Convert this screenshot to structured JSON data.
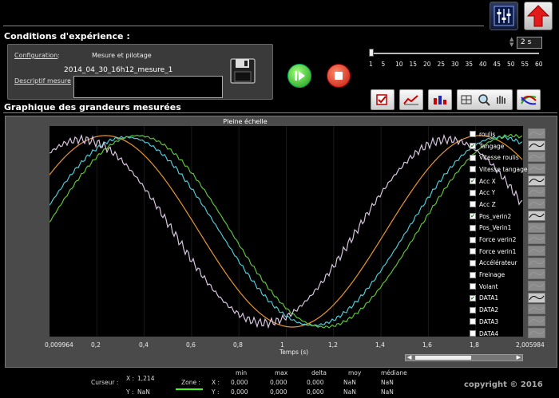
{
  "header": {
    "conditions_title": "Conditions d'expérience :",
    "graph_title": "Graphique des grandeurs mesurées"
  },
  "config": {
    "config_label": "Configuration",
    "config_value": "Mesure et pilotage",
    "filename": "2014_04_30_16h12_mesure_1",
    "description_label": "Descriptif mesure"
  },
  "timebase": {
    "value": "2 s",
    "ticks": [
      "1",
      "5",
      "10",
      "15",
      "20",
      "25",
      "30",
      "35",
      "40",
      "45",
      "50",
      "55",
      "60"
    ]
  },
  "plot": {
    "scale_label": "Pleine échelle",
    "x_label": "Temps (s)",
    "x_ticks": [
      "0,009964",
      "0,2",
      "0,4",
      "0,6",
      "0,8",
      "1",
      "1,2",
      "1,4",
      "1,6",
      "1,8",
      "2,005984"
    ]
  },
  "legend": [
    {
      "label": "roulis",
      "checked": false,
      "color": "#9a9a9a"
    },
    {
      "label": "Tangage",
      "checked": true,
      "color": "#000000"
    },
    {
      "label": "Vitesse roulis",
      "checked": false,
      "color": "#9a9a9a"
    },
    {
      "label": "Vitesse tangage",
      "checked": false,
      "color": "#9a9a9a"
    },
    {
      "label": "Acc X",
      "checked": true,
      "color": "#000000"
    },
    {
      "label": "Acc Y",
      "checked": false,
      "color": "#9a9a9a"
    },
    {
      "label": "Acc Z",
      "checked": false,
      "color": "#9a9a9a"
    },
    {
      "label": "Pos_verin2",
      "checked": true,
      "color": "#000000"
    },
    {
      "label": "Pos_Verin1",
      "checked": false,
      "color": "#9a9a9a"
    },
    {
      "label": "Force verin2",
      "checked": false,
      "color": "#9a9a9a"
    },
    {
      "label": "Force verin1",
      "checked": false,
      "color": "#9a9a9a"
    },
    {
      "label": "Accélérateur",
      "checked": false,
      "color": "#9a9a9a"
    },
    {
      "label": "Freinage",
      "checked": false,
      "color": "#9a9a9a"
    },
    {
      "label": "Volant",
      "checked": false,
      "color": "#9a9a9a"
    },
    {
      "label": "DATA1",
      "checked": true,
      "color": "#000000"
    },
    {
      "label": "DATA2",
      "checked": false,
      "color": "#9a9a9a"
    },
    {
      "label": "DATA3",
      "checked": false,
      "color": "#9a9a9a"
    },
    {
      "label": "DATA4",
      "checked": false,
      "color": "#9a9a9a"
    }
  ],
  "cursor": {
    "label": "Curseur :",
    "x_label": "X :",
    "x_value": "1,214",
    "y_label": "Y :",
    "y_value": "NaN"
  },
  "zone": {
    "label": "Zone :",
    "headers": [
      "min",
      "max",
      "delta",
      "moy",
      "médiane"
    ],
    "x_label": "X :",
    "y_label": "Y :",
    "x_values": [
      "0,000",
      "0,000",
      "0,000",
      "NaN",
      "NaN"
    ],
    "y_values": [
      "0,000",
      "0,000",
      "0,000",
      "NaN",
      "NaN"
    ]
  },
  "copyright": "copyright © 2016",
  "colors": {
    "series_orange": "#e8962e",
    "series_cyan": "#4fc9d6",
    "series_green": "#5ec23a",
    "series_pink": "#d8c4e0"
  }
}
